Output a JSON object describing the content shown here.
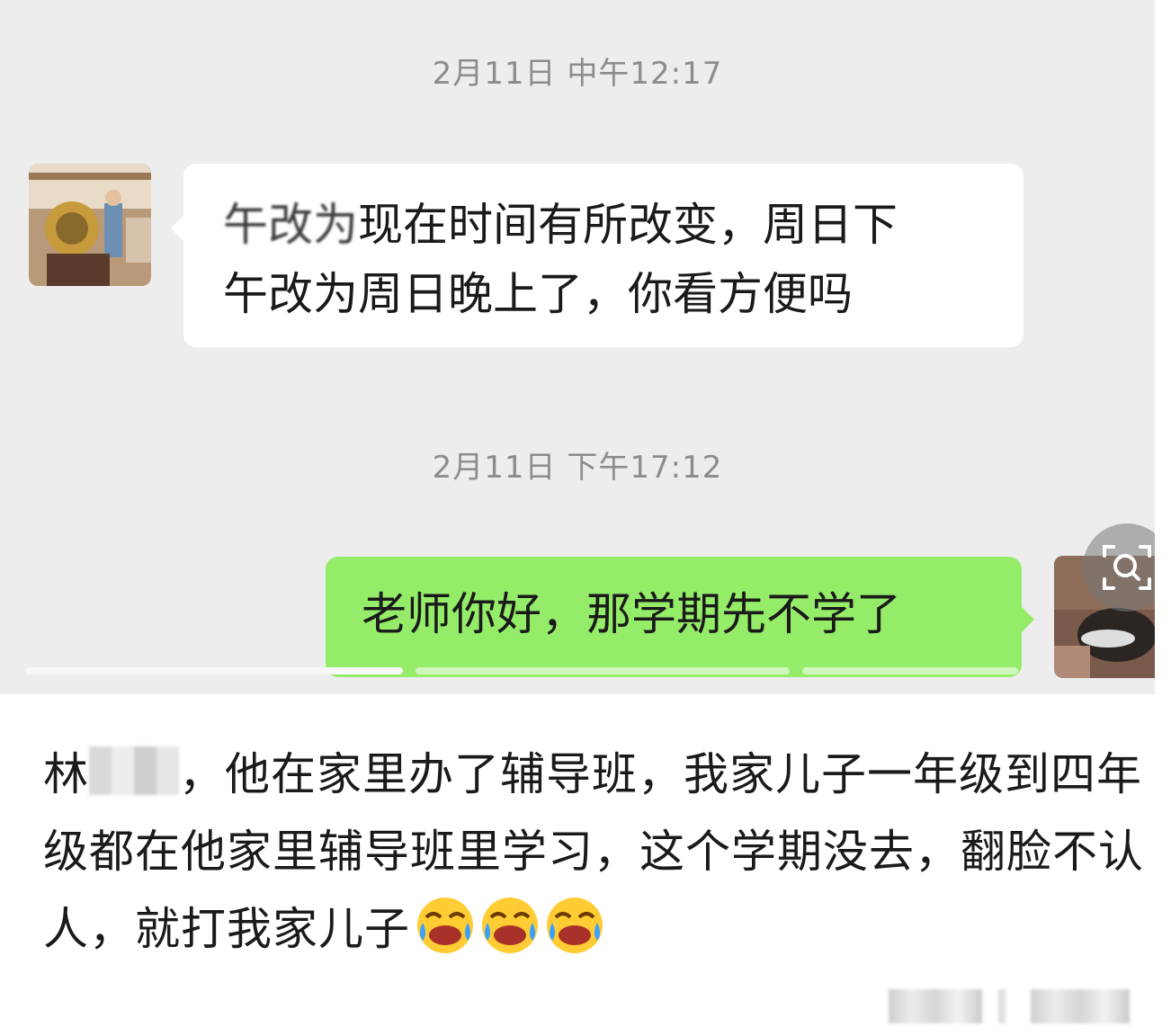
{
  "chat": {
    "timestamp_1": "2月11日 中午12:17",
    "msg_1_blurred_prefix": "午改为",
    "msg_1_line1_rest": "现在时间有所改变，周日下",
    "msg_1_line2": "午改为周日晚上了，你看方便吗",
    "timestamp_2": "2月11日 下午17:12",
    "msg_2": "老师你好，那学期先不学了"
  },
  "comment": {
    "prefix": "林",
    "text_1": "，他在家里办了辅导班，我家儿子一年级到四年级都在他家里辅导班里学习，这个学期没去，翻脸不认人，就打我家儿子",
    "emoji": "laughing-crying-emoji",
    "emoji_count": 3
  },
  "colors": {
    "chat_bg": "#ededed",
    "bubble_received": "#ffffff",
    "bubble_sent": "#95ec69",
    "timestamp": "#8c8c8c"
  }
}
